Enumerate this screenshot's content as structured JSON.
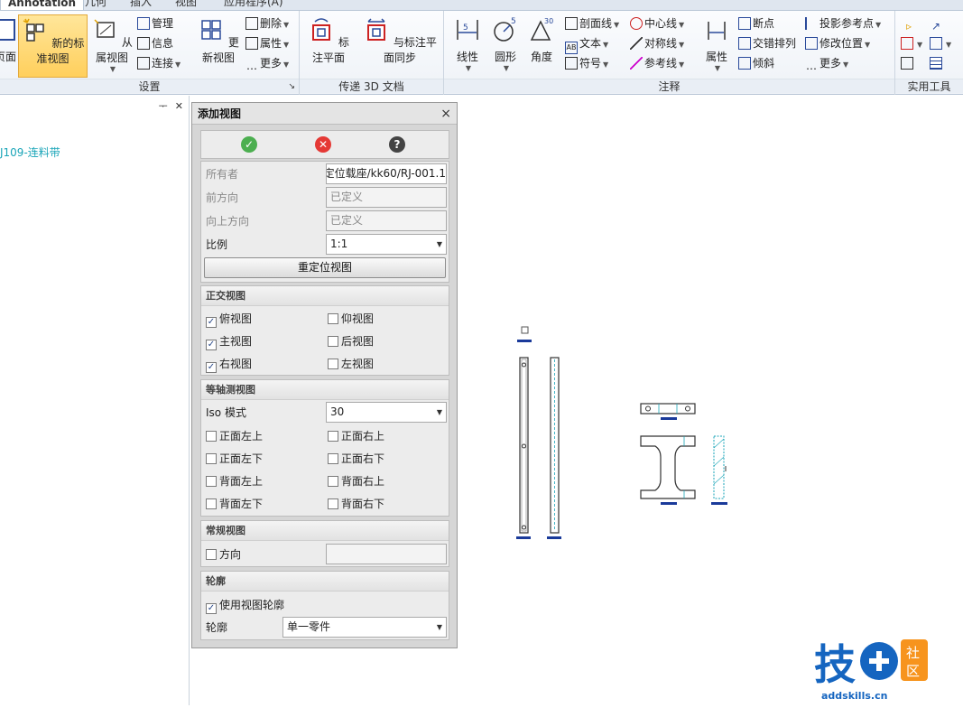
{
  "tabs": [
    "Annotation",
    "几何",
    "插入",
    "视图",
    "应用程序(A)"
  ],
  "ribbon": {
    "setup": {
      "label": "设置",
      "page_btn": "页面",
      "new_std_view": "新的标准视图",
      "from_view": "从属视图",
      "manage": "管理",
      "info": "信息",
      "connect": "连接"
    },
    "update": {
      "update_view": "更新视图",
      "delete": "删除",
      "props": "属性",
      "more": "更多"
    },
    "transfer3d": {
      "label": "传递 3D 文档",
      "annot_plane": "标注平面",
      "sync_plane": "与标注平面同步"
    },
    "annotation": {
      "label": "注释",
      "linear": "线性",
      "circle": "圆形",
      "angle": "角度",
      "section_line": "剖面线",
      "text": "文本",
      "symbol": "符号",
      "centerline": "中心线",
      "symmetry": "对称线",
      "refline": "参考线",
      "properties": "属性",
      "break": "断点",
      "stagger": "交错排列",
      "tilt": "倾斜",
      "proj_ref": "投影参考点",
      "modify_pos": "修改位置",
      "more": "更多"
    },
    "utilities": {
      "label": "实用工具"
    }
  },
  "tree": {
    "pin": "ᅮ",
    "close": "✕",
    "node": "J109-连料带"
  },
  "dialog": {
    "title": "添加视图",
    "close": "×",
    "ok_glyph": "✓",
    "cancel_glyph": "✕",
    "help_glyph": "?",
    "owner_label": "所有者",
    "owner_value": "定位载座/kk60/RJ-001.1",
    "front_label": "前方向",
    "front_value": "已定义",
    "up_label": "向上方向",
    "up_value": "已定义",
    "scale_label": "比例",
    "scale_value": "1:1",
    "reposition": "重定位视图",
    "ortho": {
      "title": "正交视图",
      "top": "俯视图",
      "bottom": "仰视图",
      "front": "主视图",
      "back": "后视图",
      "right": "右视图",
      "left": "左视图",
      "checked": {
        "top": true,
        "bottom": false,
        "front": true,
        "back": false,
        "right": true,
        "left": false
      }
    },
    "iso": {
      "title": "等轴测视图",
      "mode_label": "Iso 模式",
      "mode_value": "30",
      "fl_up": "正面左上",
      "fr_up": "正面右上",
      "fl_dn": "正面左下",
      "fr_dn": "正面右下",
      "bl_up": "背面左上",
      "br_up": "背面右上",
      "bl_dn": "背面左下",
      "br_dn": "背面右下"
    },
    "regular": {
      "title": "常规视图",
      "direction": "方向"
    },
    "outline": {
      "title": "轮廓",
      "use_outline": "使用视图轮廓",
      "outline_label": "轮廓",
      "outline_value": "单一零件"
    }
  },
  "logo": {
    "main": "技",
    "side": "社区",
    "url": "addskills.cn"
  },
  "colors": {
    "accent_active": "#ffcf5c",
    "tree_node": "#1aa5b8",
    "drawing": "#1a3a9a",
    "logo_blue": "#1565c0",
    "logo_orange": "#f7941d"
  }
}
